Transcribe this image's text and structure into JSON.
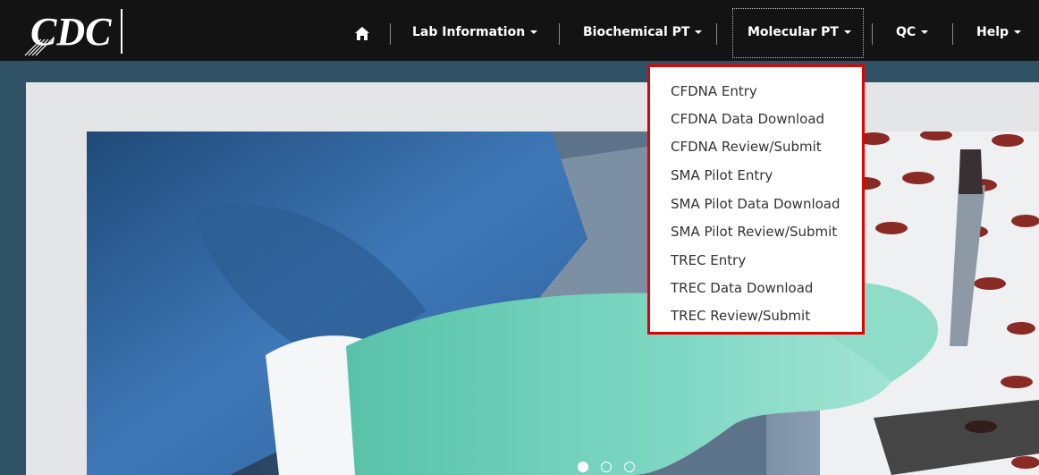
{
  "header": {
    "logo_text": "CDC",
    "nav": [
      {
        "label": "Lab Information"
      },
      {
        "label": "Biochemical PT"
      },
      {
        "label": "Molecular PT"
      },
      {
        "label": "QC"
      },
      {
        "label": "Help"
      }
    ],
    "home_icon": "home-icon"
  },
  "dropdown": {
    "items": [
      {
        "label": "CFDNA Entry"
      },
      {
        "label": "CFDNA Data Download"
      },
      {
        "label": "CFDNA Review/Submit"
      },
      {
        "label": "SMA Pilot Entry"
      },
      {
        "label": "SMA Pilot Data Download"
      },
      {
        "label": "SMA Pilot Review/Submit"
      },
      {
        "label": "TREC Entry"
      },
      {
        "label": "TREC Data Download"
      },
      {
        "label": "TREC Review/Submit"
      }
    ]
  },
  "carousel": {
    "slide_count": 3,
    "active_index": 0
  },
  "colors": {
    "navbar_bg": "#131313",
    "page_bg": "#2f5266",
    "panel_bg": "#e4e5e6",
    "dropdown_border": "#e30000",
    "glove": "#6fcfb8",
    "gown": "#4a83c4"
  }
}
